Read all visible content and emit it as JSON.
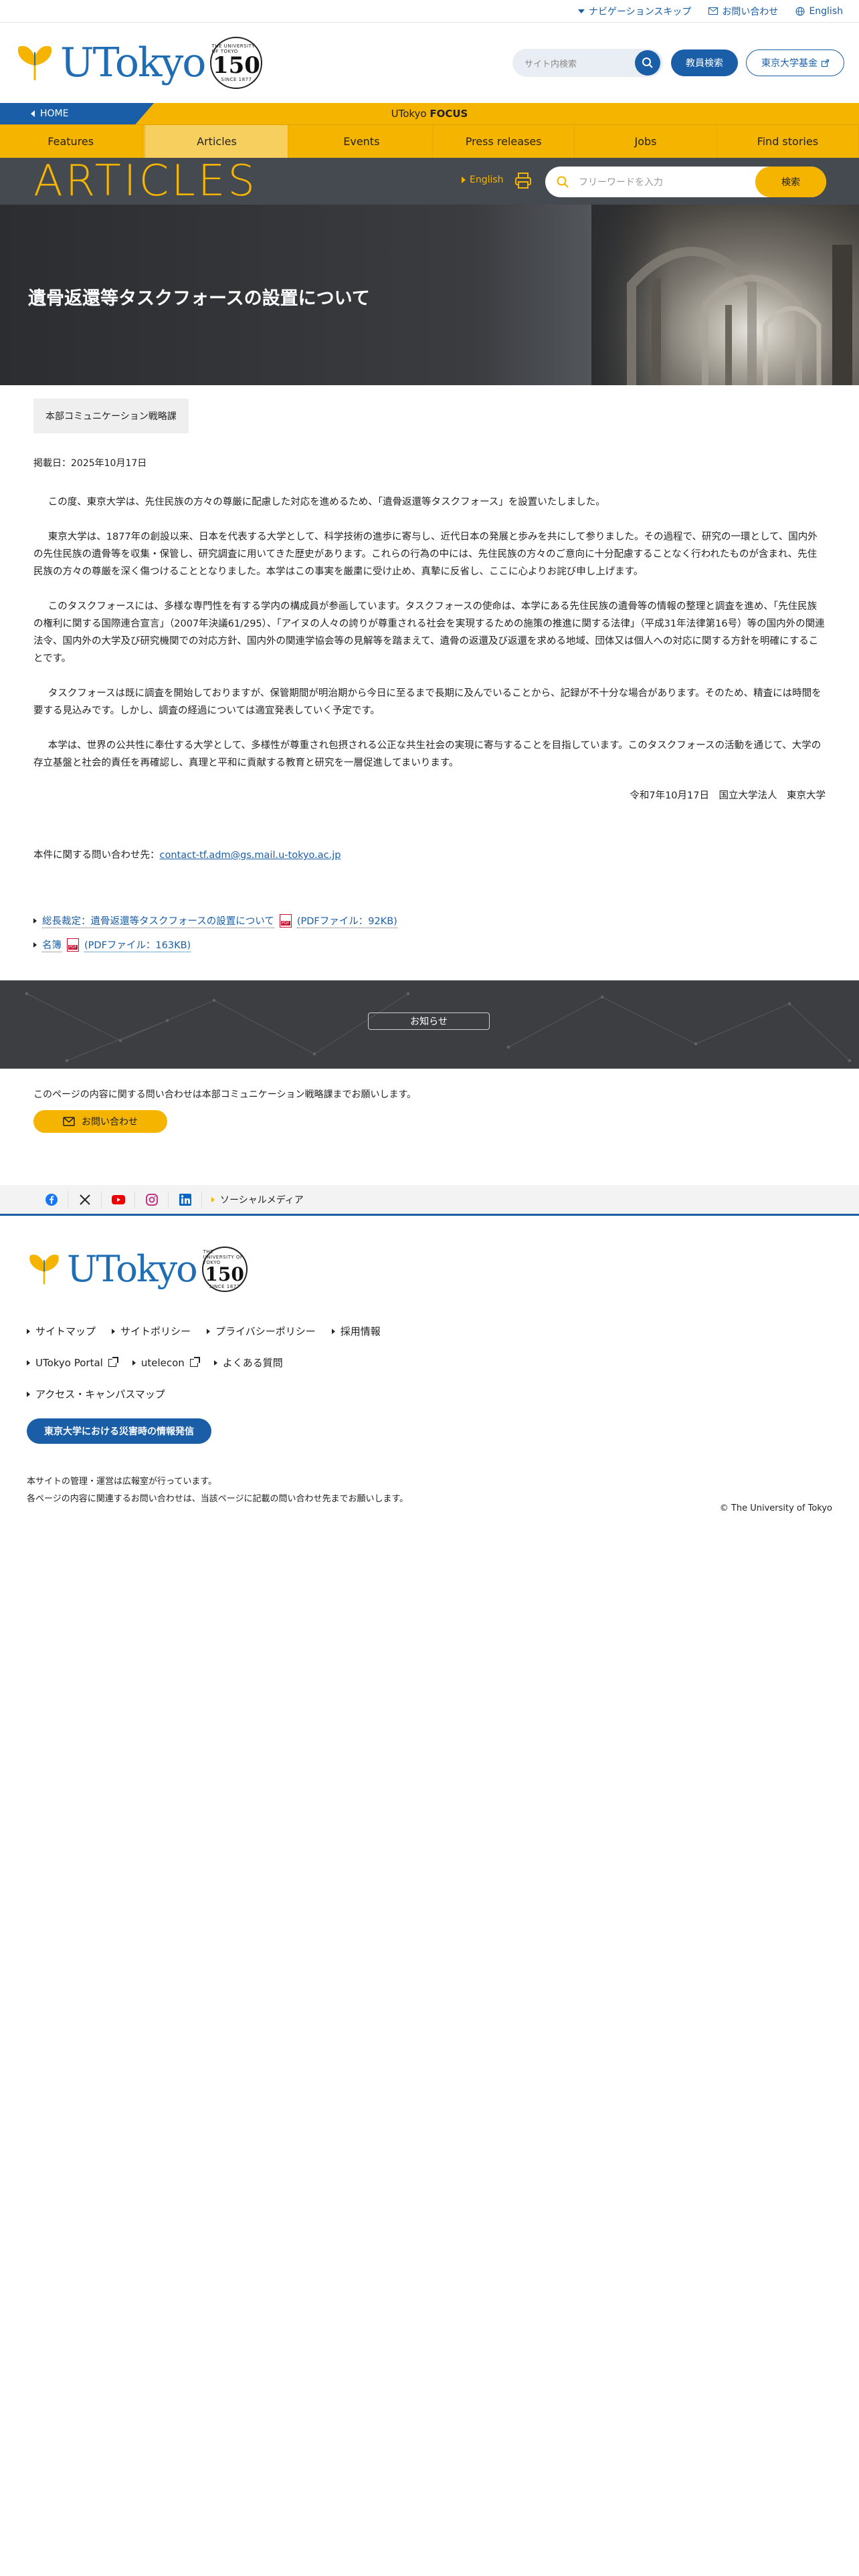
{
  "utility": {
    "skip": "ナビゲーションスキップ",
    "contact": "お問い合わせ",
    "english": "English"
  },
  "header": {
    "logo_text": "UTokyo",
    "seal_number": "150",
    "seal_top": "THE UNIVERSITY OF TOKYO",
    "seal_bottom": "SINCE 1877",
    "search_placeholder": "サイト内検索",
    "faculty_search": "教員検索",
    "fund": "東京大学基金"
  },
  "focusbar": {
    "home": "HOME",
    "title_prefix": "UTokyo ",
    "title_bold": "FOCUS"
  },
  "nav": [
    {
      "label": "Features"
    },
    {
      "label": "Articles"
    },
    {
      "label": "Events"
    },
    {
      "label": "Press releases"
    },
    {
      "label": "Jobs"
    },
    {
      "label": "Find stories"
    }
  ],
  "hero": {
    "section_title": "ARTICLES",
    "lang_link": "English",
    "search_placeholder": "フリーワードを入力",
    "search_button": "検索",
    "page_title": "遺骨返還等タスクフォースの設置について"
  },
  "article": {
    "department": "本部コミュニケーション戦略課",
    "posted": "掲載日：2025年10月17日",
    "paragraphs": [
      "この度、東京大学は、先住民族の方々の尊厳に配慮した対応を進めるため、「遺骨返還等タスクフォース」を設置いたしました。",
      "東京大学は、1877年の創設以来、日本を代表する大学として、科学技術の進歩に寄与し、近代日本の発展と歩みを共にして参りました。その過程で、研究の一環として、国内外の先住民族の遺骨等を収集・保管し、研究調査に用いてきた歴史があります。これらの行為の中には、先住民族の方々のご意向に十分配慮することなく行われたものが含まれ、先住民族の方々の尊厳を深く傷つけることとなりました。本学はこの事実を厳粛に受け止め、真摯に反省し、ここに心よりお詫び申し上げます。",
      "このタスクフォースには、多様な専門性を有する学内の構成員が参画しています。タスクフォースの使命は、本学にある先住民族の遺骨等の情報の整理と調査を進め、「先住民族の権利に関する国際連合宣言」（2007年決議61/295）、「アイヌの人々の誇りが尊重される社会を実現するための施策の推進に関する法律」（平成31年法律第16号）等の国内外の関連法令、国内外の大学及び研究機関での対応方針、国内外の関連学協会等の見解等を踏まえて、遺骨の返還及び返還を求める地域、団体又は個人への対応に関する方針を明確にすることです。",
      "タスクフォースは既に調査を開始しておりますが、保管期間が明治期から今日に至るまで長期に及んでいることから、記録が不十分な場合があります。そのため、精査には時間を要する見込みです。しかし、調査の経過については適宜発表していく予定です。",
      "本学は、世界の公共性に奉仕する大学として、多様性が尊重され包摂される公正な共生社会の実現に寄与することを目指しています。このタスクフォースの活動を通じて、大学の存立基盤と社会的責任を再確認し、真理と平和に貢献する教育と研究を一層促進してまいります。"
    ],
    "signature": "令和7年10月17日　国立大学法人　東京大学",
    "contact_label": "本件に関する問い合わせ先：",
    "contact_email": "contact-tf.adm@gs.mail.u-tokyo.ac.jp",
    "attachments": [
      {
        "title": "総長裁定：遺骨返還等タスクフォースの設置について",
        "size": "(PDFファイル：92KB)"
      },
      {
        "title": "名簿",
        "size": "(PDFファイル：163KB)"
      }
    ]
  },
  "news": {
    "button": "お知らせ"
  },
  "inquiry": {
    "text": "このページの内容に関する問い合わせは本部コミュニケーション戦略課までお願いします。",
    "button": "お問い合わせ"
  },
  "social": {
    "icons": [
      "facebook-icon",
      "x-icon",
      "youtube-icon",
      "instagram-icon",
      "linkedin-icon"
    ],
    "label": "ソーシャルメディア"
  },
  "footer": {
    "row1": [
      "サイトマップ",
      "サイトポリシー",
      "プライバシーポリシー",
      "採用情報"
    ],
    "row2": [
      "UTokyo Portal",
      "utelecon",
      "よくある質問"
    ],
    "row3": [
      "アクセス・キャンパスマップ"
    ],
    "disaster": "東京大学における災害時の情報発信",
    "note1": "本サイトの管理・運営は広報室が行っています。",
    "note2": "各ページの内容に関連するお問い合わせは、当該ページに記載の問い合わせ先までお願いします。",
    "copyright": "© The University of Tokyo"
  },
  "colors": {
    "brand_blue": "#1a5ea8",
    "brand_yellow": "#f5b400"
  }
}
